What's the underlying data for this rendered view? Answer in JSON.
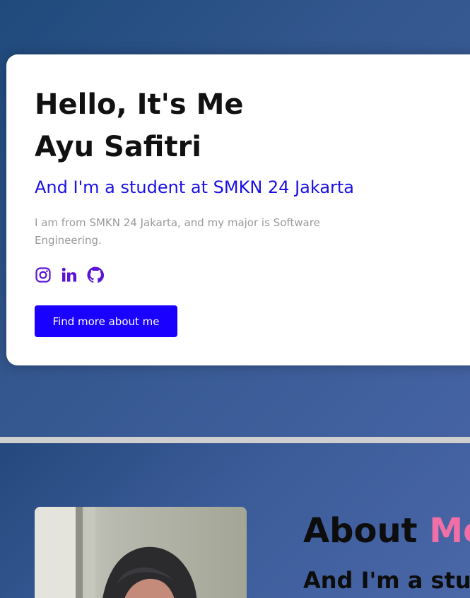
{
  "hero": {
    "greeting": "Hello, It's Me",
    "name": "Ayu Safitri",
    "tagline": "And I'm a student at SMKN 24 Jakarta",
    "description": "I am from SMKN 24 Jakarta, and my major is Software Engineering.",
    "socials": [
      {
        "icon": "instagram-icon",
        "label": "Instagram"
      },
      {
        "icon": "linkedin-icon",
        "label": "LinkedIn"
      },
      {
        "icon": "github-icon",
        "label": "GitHub"
      }
    ],
    "cta_label": "Find more about me"
  },
  "about": {
    "title_main": "About",
    "title_accent": "Me",
    "subtitle": "And I'm a stude"
  },
  "colors": {
    "accent_blue": "#1a00ff",
    "accent_pink": "#ef6fa6",
    "icon_purple": "#5a14d6",
    "background_navy": "#34578f"
  }
}
